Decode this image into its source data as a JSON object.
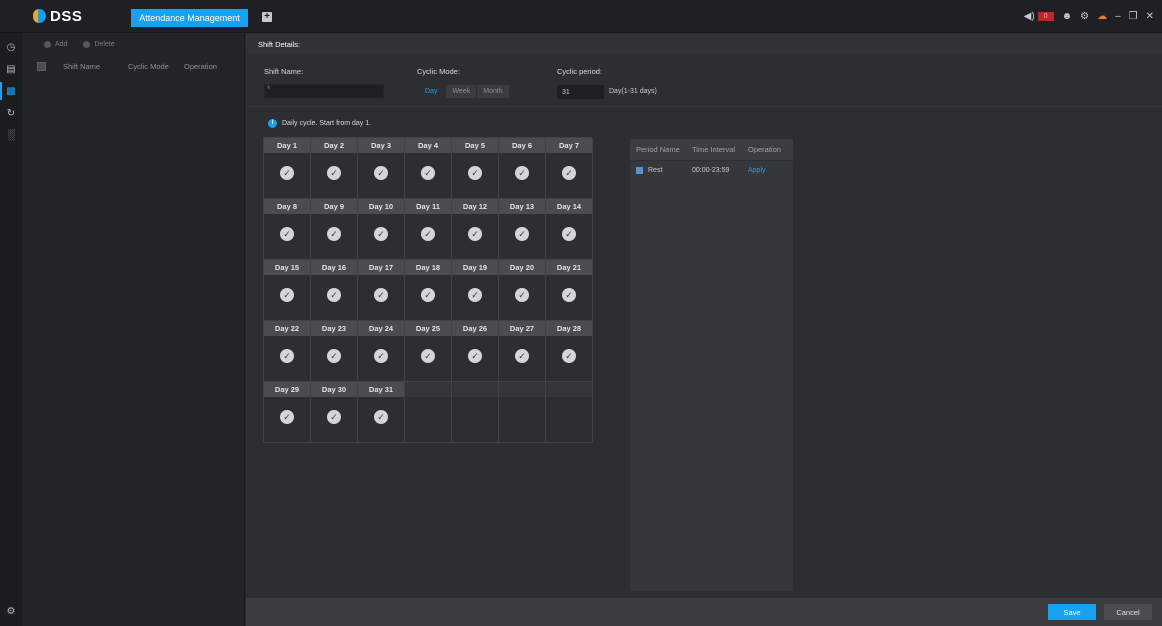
{
  "header": {
    "app_name": "DSS",
    "active_tab": "Attendance Management",
    "add_tab_glyph": "+",
    "alarm_count": "0"
  },
  "rail": [
    "clock-icon",
    "calendar-icon",
    "shift-icon",
    "sync-icon",
    "stats-icon",
    "settings-icon"
  ],
  "list": {
    "toolbar": {
      "add": "Add",
      "delete": "Delete"
    },
    "columns": {
      "name": "Shift Name",
      "mode": "Cyclic Mode",
      "operation": "Operation"
    }
  },
  "main": {
    "title": "Shift Details:",
    "shift_name_label": "Shift Name:",
    "shift_name_value": "",
    "required_mark": "*",
    "cyclic_mode_label": "Cyclic Mode:",
    "modes": [
      "Day",
      "Week",
      "Month"
    ],
    "selected_mode": "Day",
    "cyclic_period_label": "Cyclic period:",
    "cyclic_period_value": "31",
    "period_unit": "Day(1-31 days)",
    "info_text": "Daily cycle. Start from day 1.",
    "days": [
      "Day 1",
      "Day 2",
      "Day 3",
      "Day 4",
      "Day 5",
      "Day 6",
      "Day 7",
      "Day 8",
      "Day 9",
      "Day 10",
      "Day 11",
      "Day 12",
      "Day 13",
      "Day 14",
      "Day 15",
      "Day 16",
      "Day 17",
      "Day 18",
      "Day 19",
      "Day 20",
      "Day 21",
      "Day 22",
      "Day 23",
      "Day 24",
      "Day 25",
      "Day 26",
      "Day 27",
      "Day 28",
      "Day 29",
      "Day 30",
      "Day 31"
    ]
  },
  "period_table": {
    "headers": {
      "name": "Period Name",
      "interval": "Time Interval",
      "operation": "Operation"
    },
    "rows": [
      {
        "name": "Rest",
        "interval": "00:00-23:59",
        "action": "Apply"
      }
    ]
  },
  "footer": {
    "save": "Save",
    "cancel": "Cancel"
  },
  "colors": {
    "accent": "#16a2f0",
    "logo_orange": "#f4a321",
    "alarm_red": "#b32c2c"
  }
}
